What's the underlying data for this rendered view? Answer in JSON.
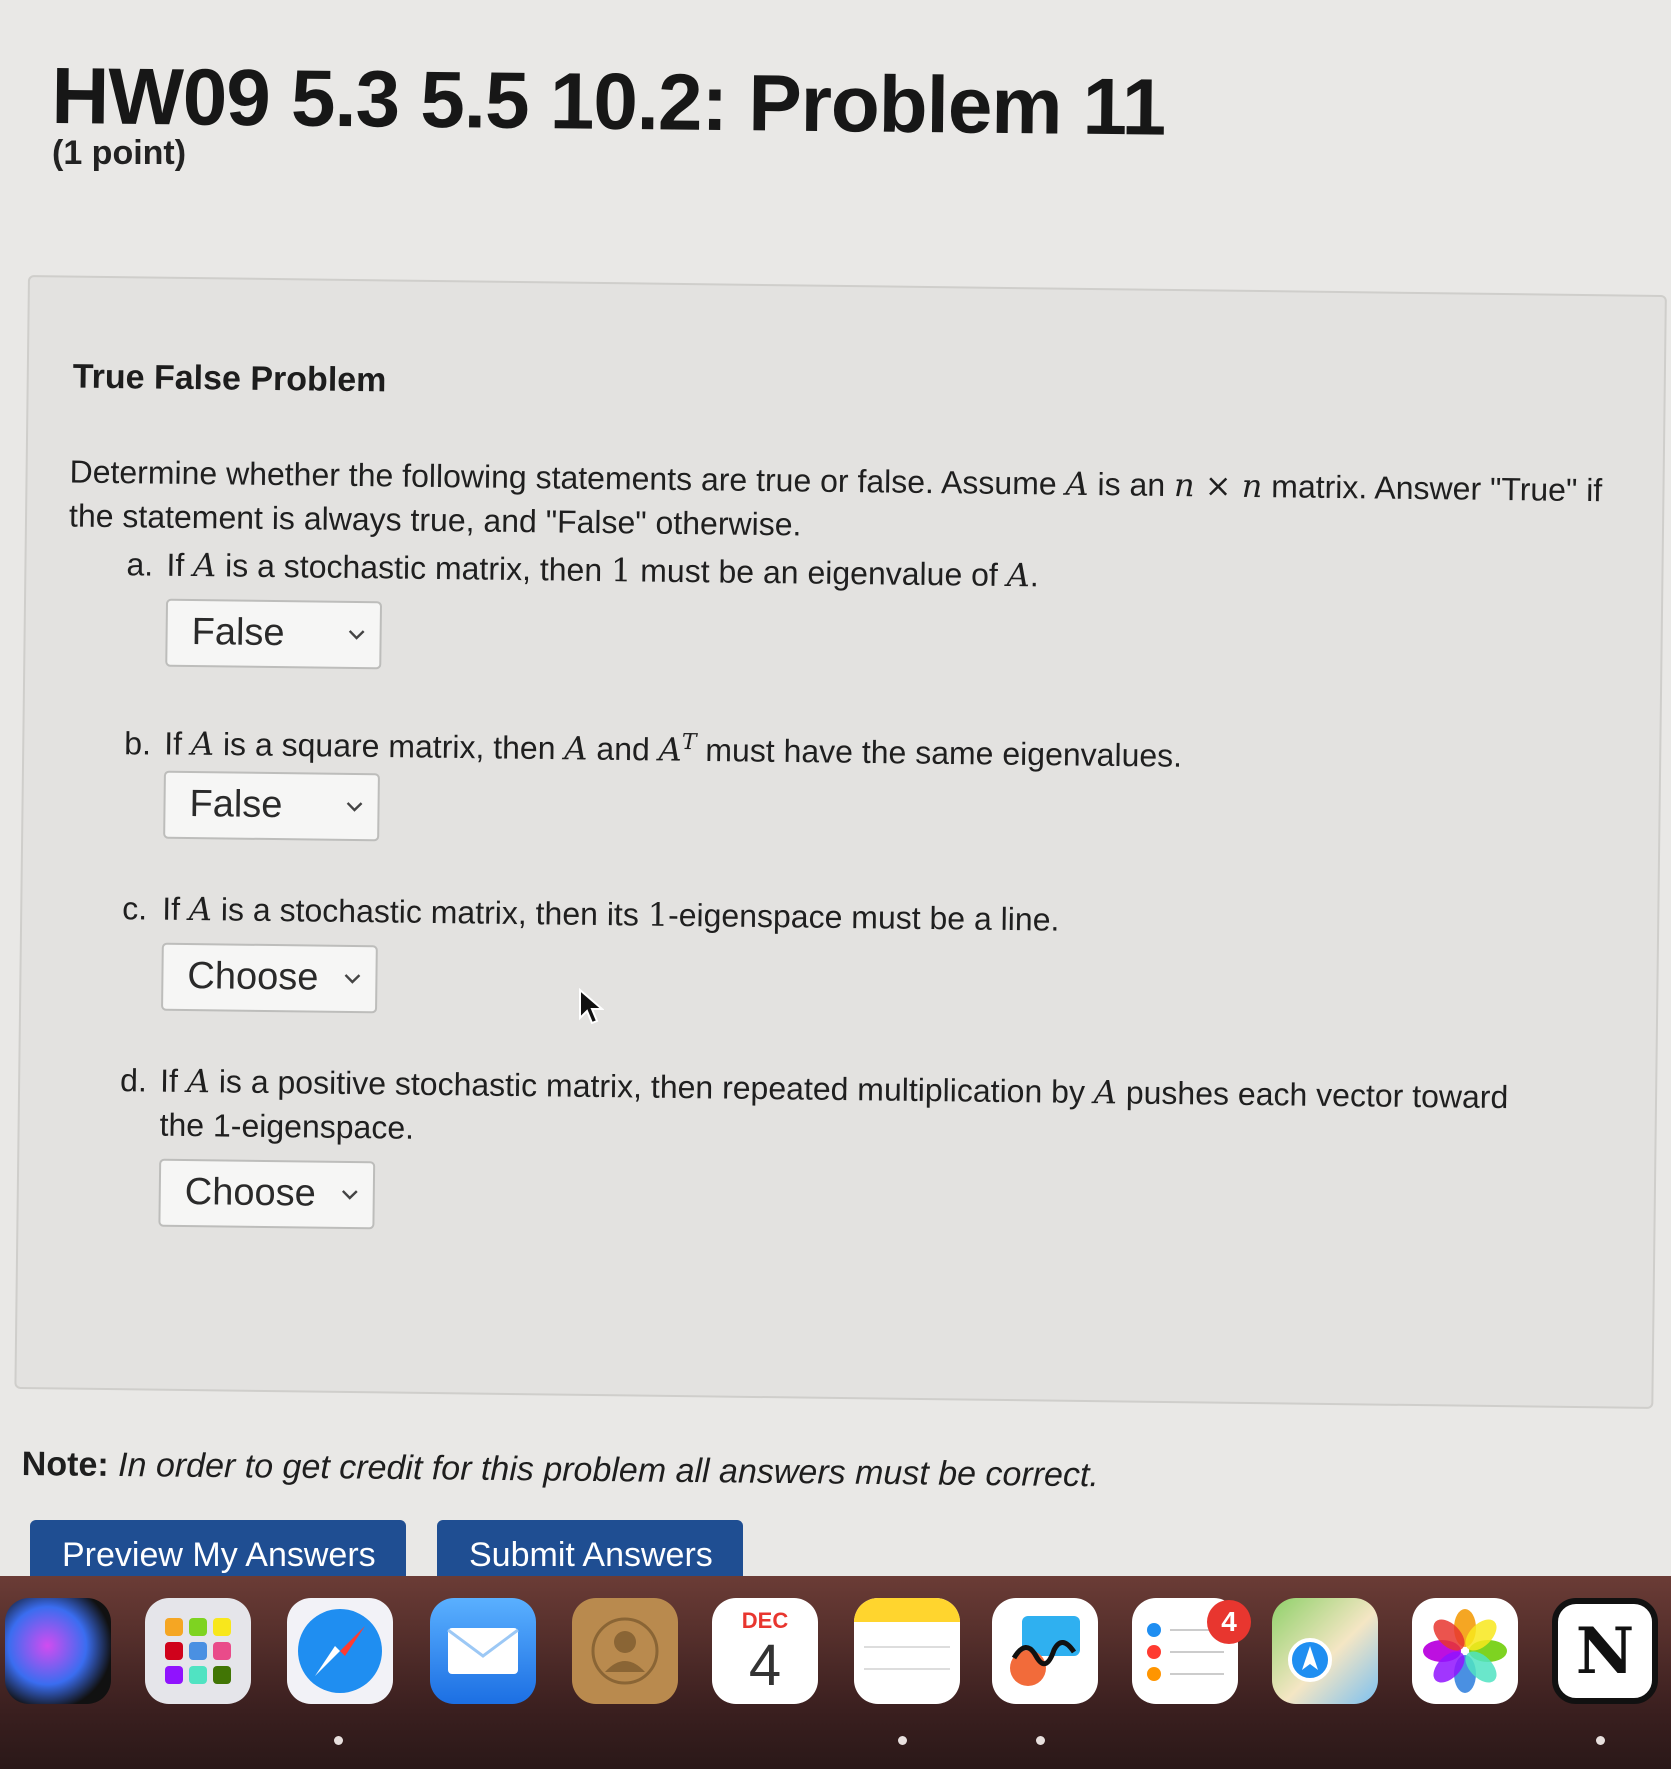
{
  "header": {
    "title": "HW09 5.3 5.5 10.2: Problem 11",
    "points": "(1 point)"
  },
  "problem": {
    "heading": "True False Problem",
    "instructions": {
      "p1": "Determine whether the following statements are true or false. Assume ",
      "A": "A",
      "p2": " is an ",
      "n1": "n",
      "times": " × ",
      "n2": "n",
      "p3": " matrix. Answer \"True\" if the statement is always true, and \"False\" otherwise."
    },
    "items": [
      {
        "letter": "a.",
        "parts": [
          "If ",
          "A",
          " is a stochastic matrix, then ",
          "1",
          " must be an eigenvalue of ",
          "A",
          "."
        ],
        "selected": "False"
      },
      {
        "letter": "b.",
        "parts": [
          "If ",
          "A",
          " is a square matrix, then ",
          "A",
          " and ",
          "A",
          "T",
          " must have the same eigenvalues."
        ],
        "selected": "False"
      },
      {
        "letter": "c.",
        "parts": [
          "If ",
          "A",
          " is a stochastic matrix, then its ",
          "1",
          "-eigenspace must be a line."
        ],
        "selected": "Choose"
      },
      {
        "letter": "d.",
        "parts": [
          "If ",
          "A",
          " is a positive stochastic matrix, then repeated multiplication by ",
          "A",
          " pushes each vector toward",
          "the 1-eigenspace."
        ],
        "selected": "Choose"
      }
    ]
  },
  "note": {
    "label": "Note:",
    "text": "In order to get credit for this problem all answers must be correct."
  },
  "buttons": {
    "preview": "Preview My Answers",
    "submit": "Submit Answers"
  },
  "dock": {
    "apps": [
      "siri-icon",
      "launchpad-icon",
      "safari-icon",
      "mail-icon",
      "contacts-icon",
      "calendar-icon",
      "notes-icon",
      "freeform-icon",
      "reminders-icon",
      "maps-icon",
      "photos-icon",
      "notion-icon"
    ],
    "calendar_month": "DEC",
    "calendar_day": "4",
    "reminders_badge": "4",
    "notion_letter": "N"
  }
}
